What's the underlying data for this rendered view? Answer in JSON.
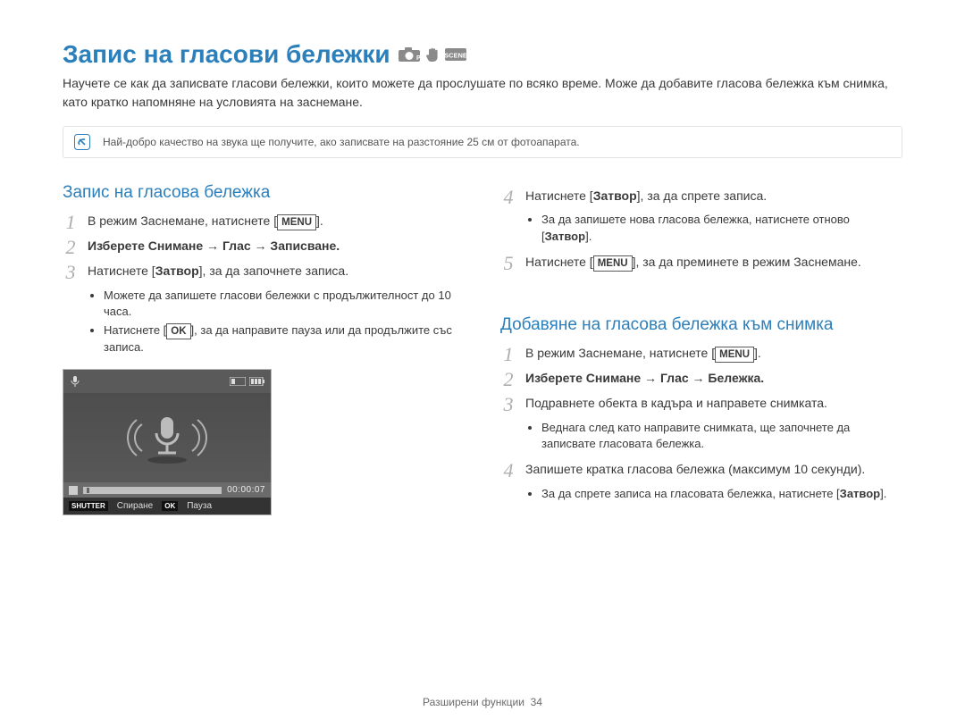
{
  "header": {
    "title": "Запис на гласови бележки",
    "intro": "Научете се как да записвате гласови бележки, които можете да прослушате по всяко време. Може да добавите гласова бележка към снимка, като кратко напомняне на условията на заснемане.",
    "note": "Най-добро качество на звука ще получите, ако записвате на разстояние 25 см от фотоапарата."
  },
  "left": {
    "title": "Запис на гласова бележка",
    "step1_pre": "В режим Заснемане, натиснете [",
    "step1_btn": "MENU",
    "step1_post": "].",
    "step2": "Изберете Снимане → Глас → Записване.",
    "step3": "Натиснете [Затвор], за да започнете записа.",
    "step3_b1": "Можете да запишете гласови бележки с продължителност до 10 часа.",
    "step3_b2_pre": "Натиснете [",
    "step3_b2_btn": "OK",
    "step3_b2_post": "], за да направите пауза или да продължите със записа."
  },
  "shot": {
    "time": "00:00:07",
    "shutter": "SHUTTER",
    "stop": "Спиране",
    "ok": "OK",
    "pause": "Пауза"
  },
  "right_top": {
    "step4": "Натиснете [Затвор], за да спрете записа.",
    "step4_b1": "За да запишете нова гласова бележка, натиснете отново [Затвор].",
    "step5_pre": "Натиснете [",
    "step5_btn": "MENU",
    "step5_post": "], за да преминете в режим Заснемане."
  },
  "right_bottom": {
    "title": "Добавяне на гласова бележка към снимка",
    "step1_pre": "В режим Заснемане, натиснете [",
    "step1_btn": "MENU",
    "step1_post": "].",
    "step2": "Изберете Снимане → Глас → Бележка.",
    "step3": "Подравнете обекта в кадъра и направете снимката.",
    "step3_b1": "Веднага след като направите снимката, ще започнете да записвате гласовата бележка.",
    "step4": "Запишете кратка гласова бележка (максимум 10 секунди).",
    "step4_b1": "За да спрете записа на гласовата бележка, натиснете [Затвор]."
  },
  "footer": {
    "section": "Разширени функции",
    "page": "34"
  }
}
